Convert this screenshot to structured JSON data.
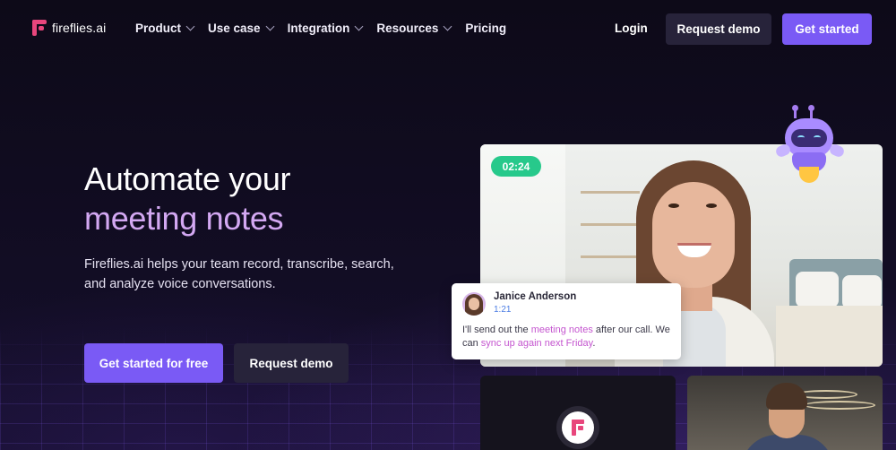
{
  "brand": {
    "name": "fireflies.ai",
    "color": "#e8467c"
  },
  "nav": {
    "items": [
      {
        "label": "Product",
        "dropdown": true
      },
      {
        "label": "Use case",
        "dropdown": true
      },
      {
        "label": "Integration",
        "dropdown": true
      },
      {
        "label": "Resources",
        "dropdown": true
      },
      {
        "label": "Pricing",
        "dropdown": false
      }
    ],
    "login": "Login",
    "request_demo": "Request demo",
    "get_started": "Get started"
  },
  "hero": {
    "title_line1": "Automate your",
    "title_line2": "meeting notes",
    "subtitle": "Fireflies.ai helps your team record, transcribe, search, and analyze voice conversations.",
    "cta_primary": "Get started for free",
    "cta_secondary": "Request demo"
  },
  "video": {
    "timer": "02:24"
  },
  "chat": {
    "name": "Janice Anderson",
    "time": "1:21",
    "msg_part1": "I'll send out the ",
    "msg_hl1": "meeting notes",
    "msg_part2": " after our call. We can ",
    "msg_hl2": "sync up again next Friday",
    "msg_part3": "."
  },
  "colors": {
    "accent": "#7a5af5",
    "background": "#0f0b1e",
    "highlight_text": "#d3a8f2",
    "timer_green": "#27c98b"
  }
}
